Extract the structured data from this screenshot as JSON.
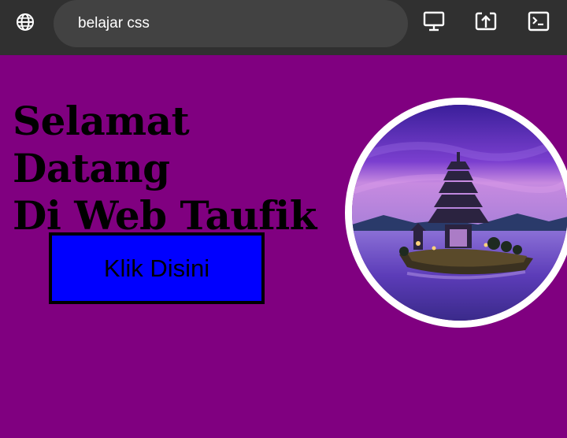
{
  "browser": {
    "address": "belajar css",
    "icons": {
      "site": "globe-icon",
      "desktop": "monitor-icon",
      "share": "share-icon",
      "devtools": "terminal-icon"
    }
  },
  "hero": {
    "line1": "Selamat Datang",
    "line2_prefix": "Di ",
    "line2_bold": "Web Taufik",
    "button_label": "Klik Disini",
    "image": "temple-on-lake-photo"
  },
  "colors": {
    "page_background": "#800080",
    "button_background": "#0000ff",
    "toolbar_background": "#303030",
    "address_bar_background": "#424242",
    "image_border": "#ffffff"
  }
}
